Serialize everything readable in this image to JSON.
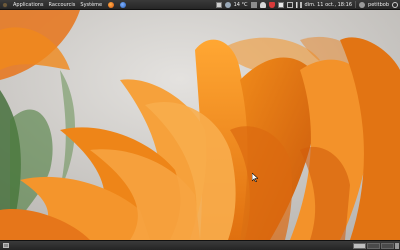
{
  "top_panel": {
    "menus": {
      "applications": "Applications",
      "places": "Raccourcis",
      "system": "Système"
    },
    "launchers": [
      "firefox-icon",
      "help-icon"
    ],
    "tray": {
      "weather": "14 °C",
      "clock": "dim. 11 oct., 18:16",
      "user": "petitbob"
    }
  },
  "wallpaper": {
    "subject": "orange-flower",
    "colors": {
      "petal": "#f08a1a",
      "petal_dark": "#d8610b",
      "background": "#d6d3cf",
      "leaf": "#3f6b34"
    }
  },
  "bottom_panel": {
    "workspaces": 3,
    "active_workspace": 1
  }
}
